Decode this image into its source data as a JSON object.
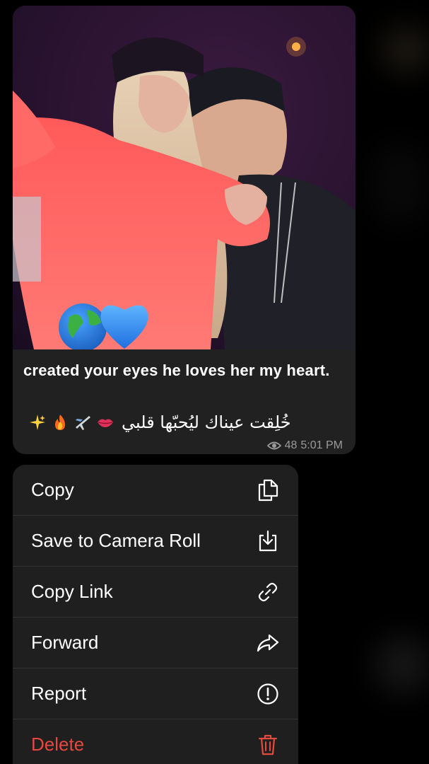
{
  "message": {
    "caption_en": "created your eyes he loves her my heart.",
    "caption_ar": "خُلِقت عيناك ليُحبّها قلبي",
    "views": "48",
    "time": "5:01 PM",
    "photo_emojis": [
      "globe-emoji",
      "blue-heart-emoji"
    ],
    "caption_emojis": [
      "lips-emoji",
      "airplane-emoji",
      "fire-emoji",
      "sparkles-emoji"
    ]
  },
  "menu": {
    "items": [
      {
        "label": "Copy",
        "icon": "copy-icon"
      },
      {
        "label": "Save to Camera Roll",
        "icon": "save-download-icon"
      },
      {
        "label": "Copy Link",
        "icon": "link-icon"
      },
      {
        "label": "Forward",
        "icon": "forward-arrow-icon"
      },
      {
        "label": "Report",
        "icon": "exclamation-circle-icon"
      },
      {
        "label": "Delete",
        "icon": "trash-icon"
      }
    ]
  },
  "colors": {
    "bubble": "#212121",
    "menu": "#1f1f1f",
    "destructive": "#e5493e",
    "meta": "#9a9a9a"
  }
}
